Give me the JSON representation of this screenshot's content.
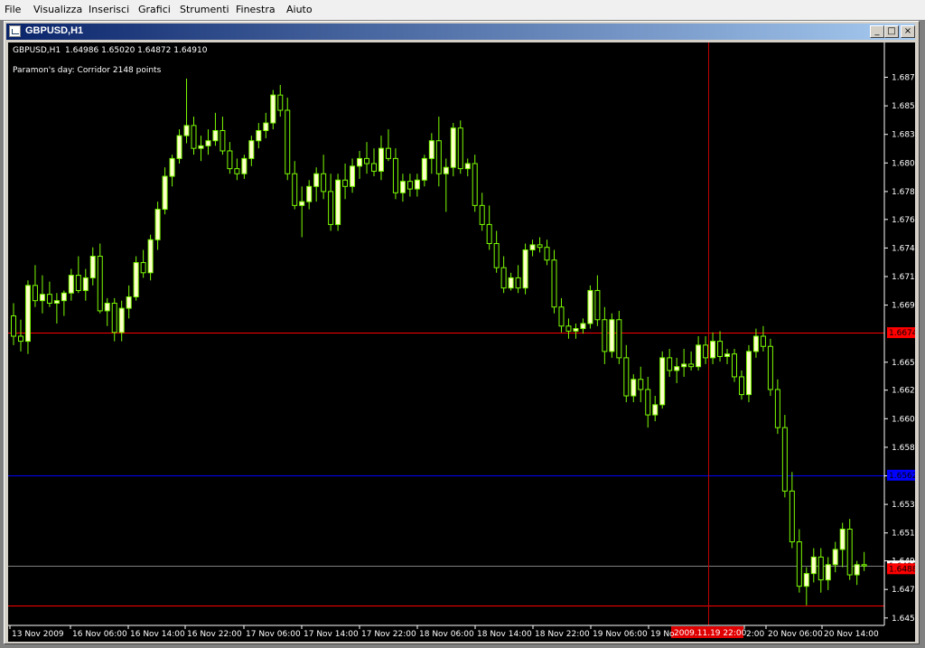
{
  "menu": [
    "File",
    "Visualizza",
    "Inserisci",
    "Grafici",
    "Strumenti",
    "Finestra",
    "Aiuto"
  ],
  "window": {
    "title": "GBPUSD,H1",
    "min_glyph": "_",
    "max_glyph": "□",
    "close_glyph": "×"
  },
  "chart_header": {
    "symbol_tf": "GBPUSD,H1",
    "ohlc": "1.64986 1.65020 1.64872 1.64910",
    "indicator": "Paramon's day: Corridor 2148 points"
  },
  "colors": {
    "background": "#000000",
    "candle": "#7cfc00",
    "bull_fill": "#ffffcc",
    "grid_text": "#ffffff",
    "corridor_line": "#ff0000",
    "mid_line": "#0000ff",
    "bid_line": "#808080",
    "crosshair": "#c00000"
  },
  "chart_data": {
    "type": "candlestick",
    "symbol": "GBPUSD",
    "timeframe": "H1",
    "y_ticks": [
      "1.68760",
      "1.68535",
      "1.68310",
      "1.68085",
      "1.67860",
      "1.67640",
      "1.67415",
      "1.67190",
      "1.66965",
      "1.66515",
      "1.66295",
      "1.66070",
      "1.65845",
      "1.65620",
      "1.65395",
      "1.65170",
      "1.64950",
      "1.64725",
      "1.64500"
    ],
    "ylim": [
      1.6447,
      1.6902
    ],
    "x_ticks": [
      "13 Nov 2009",
      "16 Nov 06:00",
      "16 Nov 14:00",
      "16 Nov 22:00",
      "17 Nov 06:00",
      "17 Nov 14:00",
      "17 Nov 22:00",
      "18 Nov 06:00",
      "18 Nov 14:00",
      "18 Nov 22:00",
      "19 Nov 06:00",
      "19 No",
      "2:00",
      "20 Nov 06:00",
      "20 Nov 14:00"
    ],
    "price_labels": [
      {
        "text": "1.66748",
        "value": 1.66748,
        "color": "#ff0000"
      },
      {
        "text": "1.65620",
        "value": 1.65625,
        "color": "#0000ff"
      },
      {
        "text": "1.64910",
        "value": 1.6491,
        "color": "#ffffff"
      },
      {
        "text": "1.64888",
        "value": 1.64888,
        "color": "#ff0000"
      }
    ],
    "hlines": [
      {
        "value": 1.66748,
        "color": "#ff0000"
      },
      {
        "value": 1.65625,
        "color": "#0000ff"
      },
      {
        "value": 1.6491,
        "color": "#808080"
      },
      {
        "value": 1.646,
        "color": "#ff0000"
      }
    ],
    "crosshair": {
      "time_label": "2009.11.19 22:00",
      "price_label": "1.64888"
    },
    "candles": [
      [
        1.6688,
        1.6698,
        1.6665,
        1.6672
      ],
      [
        1.6672,
        1.6685,
        1.666,
        1.6668
      ],
      [
        1.6668,
        1.6716,
        1.6658,
        1.6712
      ],
      [
        1.6712,
        1.6728,
        1.6695,
        1.67
      ],
      [
        1.67,
        1.672,
        1.669,
        1.6705
      ],
      [
        1.6705,
        1.6715,
        1.6695,
        1.6698
      ],
      [
        1.6698,
        1.6706,
        1.6682,
        1.67
      ],
      [
        1.67,
        1.6708,
        1.6688,
        1.6706
      ],
      [
        1.6706,
        1.6725,
        1.67,
        1.672
      ],
      [
        1.672,
        1.6735,
        1.6706,
        1.6708
      ],
      [
        1.6708,
        1.6725,
        1.67,
        1.6718
      ],
      [
        1.6718,
        1.6742,
        1.6712,
        1.6735
      ],
      [
        1.6735,
        1.6745,
        1.669,
        1.6692
      ],
      [
        1.6692,
        1.6702,
        1.668,
        1.6698
      ],
      [
        1.6698,
        1.6702,
        1.6668,
        1.6675
      ],
      [
        1.6675,
        1.67,
        1.6668,
        1.6694
      ],
      [
        1.6694,
        1.6712,
        1.6686,
        1.6703
      ],
      [
        1.6703,
        1.6735,
        1.67,
        1.673
      ],
      [
        1.673,
        1.674,
        1.6718,
        1.6722
      ],
      [
        1.6722,
        1.6752,
        1.6716,
        1.6748
      ],
      [
        1.6748,
        1.6778,
        1.674,
        1.6772
      ],
      [
        1.6772,
        1.6805,
        1.6768,
        1.6798
      ],
      [
        1.6798,
        1.6815,
        1.679,
        1.6812
      ],
      [
        1.6812,
        1.6835,
        1.6808,
        1.683
      ],
      [
        1.683,
        1.6875,
        1.6824,
        1.6838
      ],
      [
        1.6838,
        1.6845,
        1.6815,
        1.682
      ],
      [
        1.682,
        1.683,
        1.681,
        1.6822
      ],
      [
        1.6822,
        1.6835,
        1.6815,
        1.6826
      ],
      [
        1.6826,
        1.6848,
        1.6822,
        1.6834
      ],
      [
        1.6834,
        1.6845,
        1.6815,
        1.6818
      ],
      [
        1.6818,
        1.6825,
        1.68,
        1.6804
      ],
      [
        1.6804,
        1.6812,
        1.6795,
        1.68
      ],
      [
        1.68,
        1.6815,
        1.6796,
        1.6812
      ],
      [
        1.6812,
        1.683,
        1.6806,
        1.6826
      ],
      [
        1.6826,
        1.684,
        1.682,
        1.6834
      ],
      [
        1.6834,
        1.6848,
        1.6828,
        1.684
      ],
      [
        1.684,
        1.6866,
        1.6835,
        1.6862
      ],
      [
        1.6862,
        1.687,
        1.6845,
        1.685
      ],
      [
        1.685,
        1.686,
        1.6795,
        1.68
      ],
      [
        1.68,
        1.681,
        1.6772,
        1.6775
      ],
      [
        1.6775,
        1.679,
        1.675,
        1.6778
      ],
      [
        1.6778,
        1.6795,
        1.6772,
        1.679
      ],
      [
        1.679,
        1.6805,
        1.6778,
        1.68
      ],
      [
        1.68,
        1.6815,
        1.678,
        1.6786
      ],
      [
        1.6786,
        1.68,
        1.6755,
        1.676
      ],
      [
        1.676,
        1.68,
        1.6755,
        1.6795
      ],
      [
        1.6795,
        1.6808,
        1.678,
        1.679
      ],
      [
        1.679,
        1.6812,
        1.6785,
        1.6806
      ],
      [
        1.6806,
        1.6818,
        1.6796,
        1.6812
      ],
      [
        1.6812,
        1.6825,
        1.68,
        1.6808
      ],
      [
        1.6808,
        1.682,
        1.6798,
        1.6802
      ],
      [
        1.6802,
        1.683,
        1.6795,
        1.682
      ],
      [
        1.682,
        1.6835,
        1.681,
        1.6812
      ],
      [
        1.6812,
        1.682,
        1.678,
        1.6785
      ],
      [
        1.6785,
        1.68,
        1.6778,
        1.6794
      ],
      [
        1.6794,
        1.68,
        1.6782,
        1.6788
      ],
      [
        1.6788,
        1.68,
        1.6782,
        1.6795
      ],
      [
        1.6795,
        1.6815,
        1.679,
        1.6812
      ],
      [
        1.6812,
        1.6832,
        1.68,
        1.6826
      ],
      [
        1.6826,
        1.6845,
        1.679,
        1.68
      ],
      [
        1.68,
        1.6812,
        1.677,
        1.6805
      ],
      [
        1.6805,
        1.684,
        1.6798,
        1.6836
      ],
      [
        1.6836,
        1.6842,
        1.68,
        1.6804
      ],
      [
        1.6804,
        1.6812,
        1.6798,
        1.6808
      ],
      [
        1.6808,
        1.6815,
        1.677,
        1.6775
      ],
      [
        1.6775,
        1.6785,
        1.6755,
        1.676
      ],
      [
        1.676,
        1.6775,
        1.674,
        1.6745
      ],
      [
        1.6745,
        1.6755,
        1.6722,
        1.6726
      ],
      [
        1.6726,
        1.6735,
        1.6706,
        1.671
      ],
      [
        1.671,
        1.6722,
        1.6708,
        1.6718
      ],
      [
        1.6718,
        1.6728,
        1.6706,
        1.671
      ],
      [
        1.671,
        1.6745,
        1.6705,
        1.674
      ],
      [
        1.674,
        1.6748,
        1.6735,
        1.6744
      ],
      [
        1.6744,
        1.675,
        1.6738,
        1.6742
      ],
      [
        1.6742,
        1.6748,
        1.6728,
        1.6732
      ],
      [
        1.6732,
        1.674,
        1.669,
        1.6695
      ],
      [
        1.6695,
        1.6702,
        1.6675,
        1.668
      ],
      [
        1.668,
        1.6686,
        1.667,
        1.6676
      ],
      [
        1.6676,
        1.6682,
        1.667,
        1.6678
      ],
      [
        1.6678,
        1.6686,
        1.6674,
        1.6682
      ],
      [
        1.6682,
        1.6712,
        1.6678,
        1.6708
      ],
      [
        1.6708,
        1.672,
        1.668,
        1.6685
      ],
      [
        1.6685,
        1.6695,
        1.665,
        1.666
      ],
      [
        1.666,
        1.669,
        1.6655,
        1.6685
      ],
      [
        1.6685,
        1.6692,
        1.665,
        1.6655
      ],
      [
        1.6655,
        1.6665,
        1.662,
        1.6625
      ],
      [
        1.6625,
        1.6642,
        1.662,
        1.6638
      ],
      [
        1.6638,
        1.6648,
        1.662,
        1.663
      ],
      [
        1.663,
        1.664,
        1.66,
        1.661
      ],
      [
        1.661,
        1.6625,
        1.6605,
        1.6618
      ],
      [
        1.6618,
        1.666,
        1.6615,
        1.6655
      ],
      [
        1.6655,
        1.6662,
        1.664,
        1.6645
      ],
      [
        1.6645,
        1.6655,
        1.6635,
        1.6648
      ],
      [
        1.6648,
        1.6662,
        1.664,
        1.665
      ],
      [
        1.665,
        1.666,
        1.6645,
        1.6648
      ],
      [
        1.6648,
        1.6672,
        1.6645,
        1.6665
      ],
      [
        1.6665,
        1.6672,
        1.665,
        1.6655
      ],
      [
        1.6655,
        1.6675,
        1.665,
        1.6668
      ],
      [
        1.6668,
        1.6676,
        1.6652,
        1.6656
      ],
      [
        1.6656,
        1.6662,
        1.665,
        1.6658
      ],
      [
        1.6658,
        1.6662,
        1.6636,
        1.664
      ],
      [
        1.664,
        1.6645,
        1.6622,
        1.6626
      ],
      [
        1.6626,
        1.6665,
        1.662,
        1.666
      ],
      [
        1.666,
        1.6678,
        1.6655,
        1.6672
      ],
      [
        1.6672,
        1.668,
        1.666,
        1.6664
      ],
      [
        1.6664,
        1.667,
        1.6625,
        1.663
      ],
      [
        1.663,
        1.6638,
        1.6595,
        1.66
      ],
      [
        1.66,
        1.661,
        1.6545,
        1.655
      ],
      [
        1.655,
        1.6565,
        1.6505,
        1.651
      ],
      [
        1.651,
        1.652,
        1.647,
        1.6475
      ],
      [
        1.6475,
        1.649,
        1.646,
        1.6485
      ],
      [
        1.6485,
        1.6505,
        1.6478,
        1.6498
      ],
      [
        1.6498,
        1.6505,
        1.647,
        1.648
      ],
      [
        1.648,
        1.6498,
        1.6472,
        1.6492
      ],
      [
        1.6492,
        1.651,
        1.6486,
        1.6504
      ],
      [
        1.6504,
        1.6525,
        1.649,
        1.652
      ],
      [
        1.652,
        1.6528,
        1.648,
        1.6484
      ],
      [
        1.6484,
        1.6495,
        1.6476,
        1.6492
      ],
      [
        1.6492,
        1.6502,
        1.6487,
        1.6491
      ]
    ]
  }
}
